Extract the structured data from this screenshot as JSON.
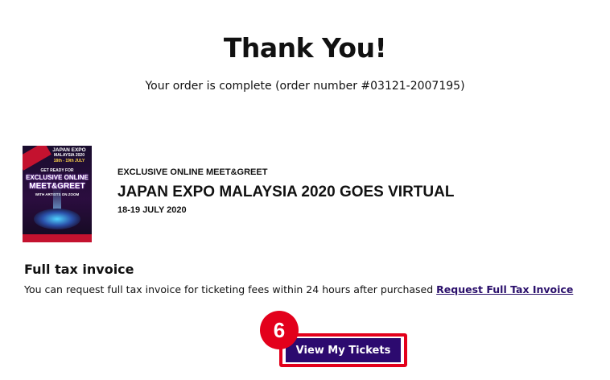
{
  "header": {
    "title": "Thank You!",
    "subtitle": "Your order is complete (order number #03121-2007195)"
  },
  "event": {
    "kicker": "EXCLUSIVE ONLINE MEET&GREET",
    "title": "JAPAN EXPO MALAYSIA 2020 GOES VIRTUAL",
    "date": "18-19 JULY 2020",
    "poster": {
      "brand": "JAPAN EXPO",
      "line1": "JAPAN EXPO",
      "line2": "MALAYSIA 2020",
      "dates": "18th - 19th JULY",
      "teaser": "GET READY FOR",
      "headline1": "EXCLUSIVE ONLINE",
      "headline2": "MEET&GREET",
      "tagline": "WITH ARTISTS ON ZOOM"
    }
  },
  "tax": {
    "title": "Full tax invoice",
    "description": "You can request full tax invoice for ticketing fees within 24 hours after purchased",
    "link_label": "Request Full Tax Invoice"
  },
  "actions": {
    "view_tickets_label": "View My Tickets",
    "step_number": "6"
  },
  "colors": {
    "button_bg": "#2c0a6f",
    "highlight": "#e3001b",
    "link": "#2a0f6b"
  }
}
